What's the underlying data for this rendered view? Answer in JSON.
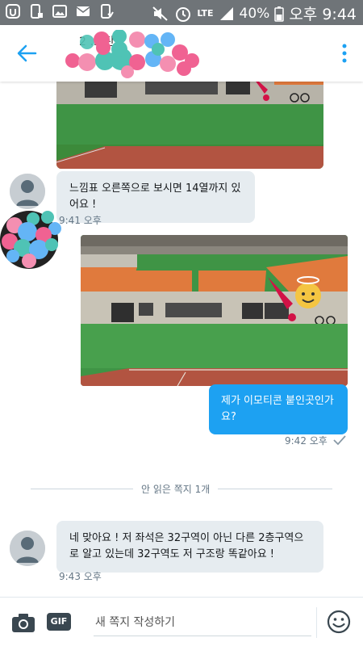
{
  "status_bar": {
    "battery": "40%",
    "time": "오후 9:44",
    "network": "LTE"
  },
  "header": {
    "title": "2 ... 탄"
  },
  "messages": {
    "m1_text": "느낌표 오른쪽으로 보시면 14열까지 있어요 !",
    "m1_time": "9:41 오후",
    "m2_text": "제가 이모티콘 붙인곳인가요?",
    "m2_time": "9:42 오후",
    "divider": "안 읽은 쪽지 1개",
    "m3_text": "네 맞아요 ! 저 좌석은 32구역이 아닌 다른 2층구역으로 알고 있는데 32구역도 저 구조랑 똑같아요 !",
    "m3_time": "9:43 오후"
  },
  "composer": {
    "placeholder": "새 쪽지 작성하기",
    "gif_label": "GIF"
  },
  "colors": {
    "accent": "#1da1f2",
    "bubble_in": "#e6ecf0",
    "statusbar": "#6f7478"
  }
}
